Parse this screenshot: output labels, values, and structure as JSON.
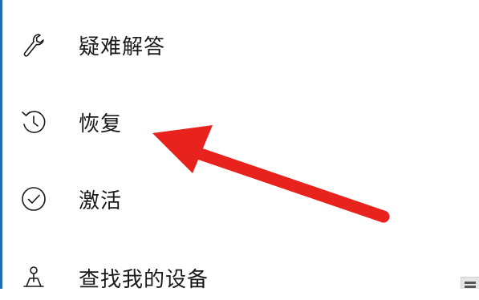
{
  "nav": {
    "items": [
      {
        "id": "troubleshoot",
        "label": "疑难解答",
        "icon": "wrench-icon"
      },
      {
        "id": "recovery",
        "label": "恢复",
        "icon": "history-icon"
      },
      {
        "id": "activation",
        "label": "激活",
        "icon": "check-circle-icon"
      },
      {
        "id": "find-device",
        "label": "查找我的设备",
        "icon": "person-locate-icon"
      }
    ]
  },
  "annotation": {
    "arrow_color": "#e8221d",
    "points_to": "recovery"
  },
  "colors": {
    "text": "#1a1a1a",
    "background": "#ffffff",
    "window_edge": "#1f6fb5"
  }
}
